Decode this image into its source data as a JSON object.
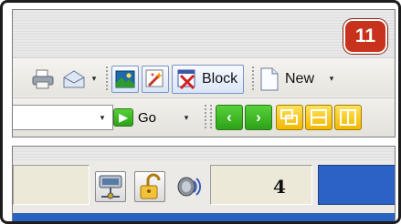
{
  "badge": {
    "number": "11",
    "color": "#c8321c"
  },
  "toolbar1": {
    "icons": [
      "printer-icon",
      "mail-icon",
      "image-icon",
      "spark-icon",
      "popup-block-icon",
      "new-page-icon"
    ],
    "block_label": "Block",
    "new_label": "New",
    "dropdown_glyph": "▾"
  },
  "toolbar2": {
    "address_value": "",
    "go_label": "Go",
    "dropdown_glyph": "▾",
    "nav_back_glyph": "‹",
    "nav_forward_glyph": "›",
    "accent_green": "#35b31f",
    "accent_yellow": "#f5c400"
  },
  "statusbar": {
    "icons": [
      "network-icon",
      "lock-icon",
      "speaker-icon"
    ],
    "count": "4",
    "progress_color": "#2c62c4"
  }
}
